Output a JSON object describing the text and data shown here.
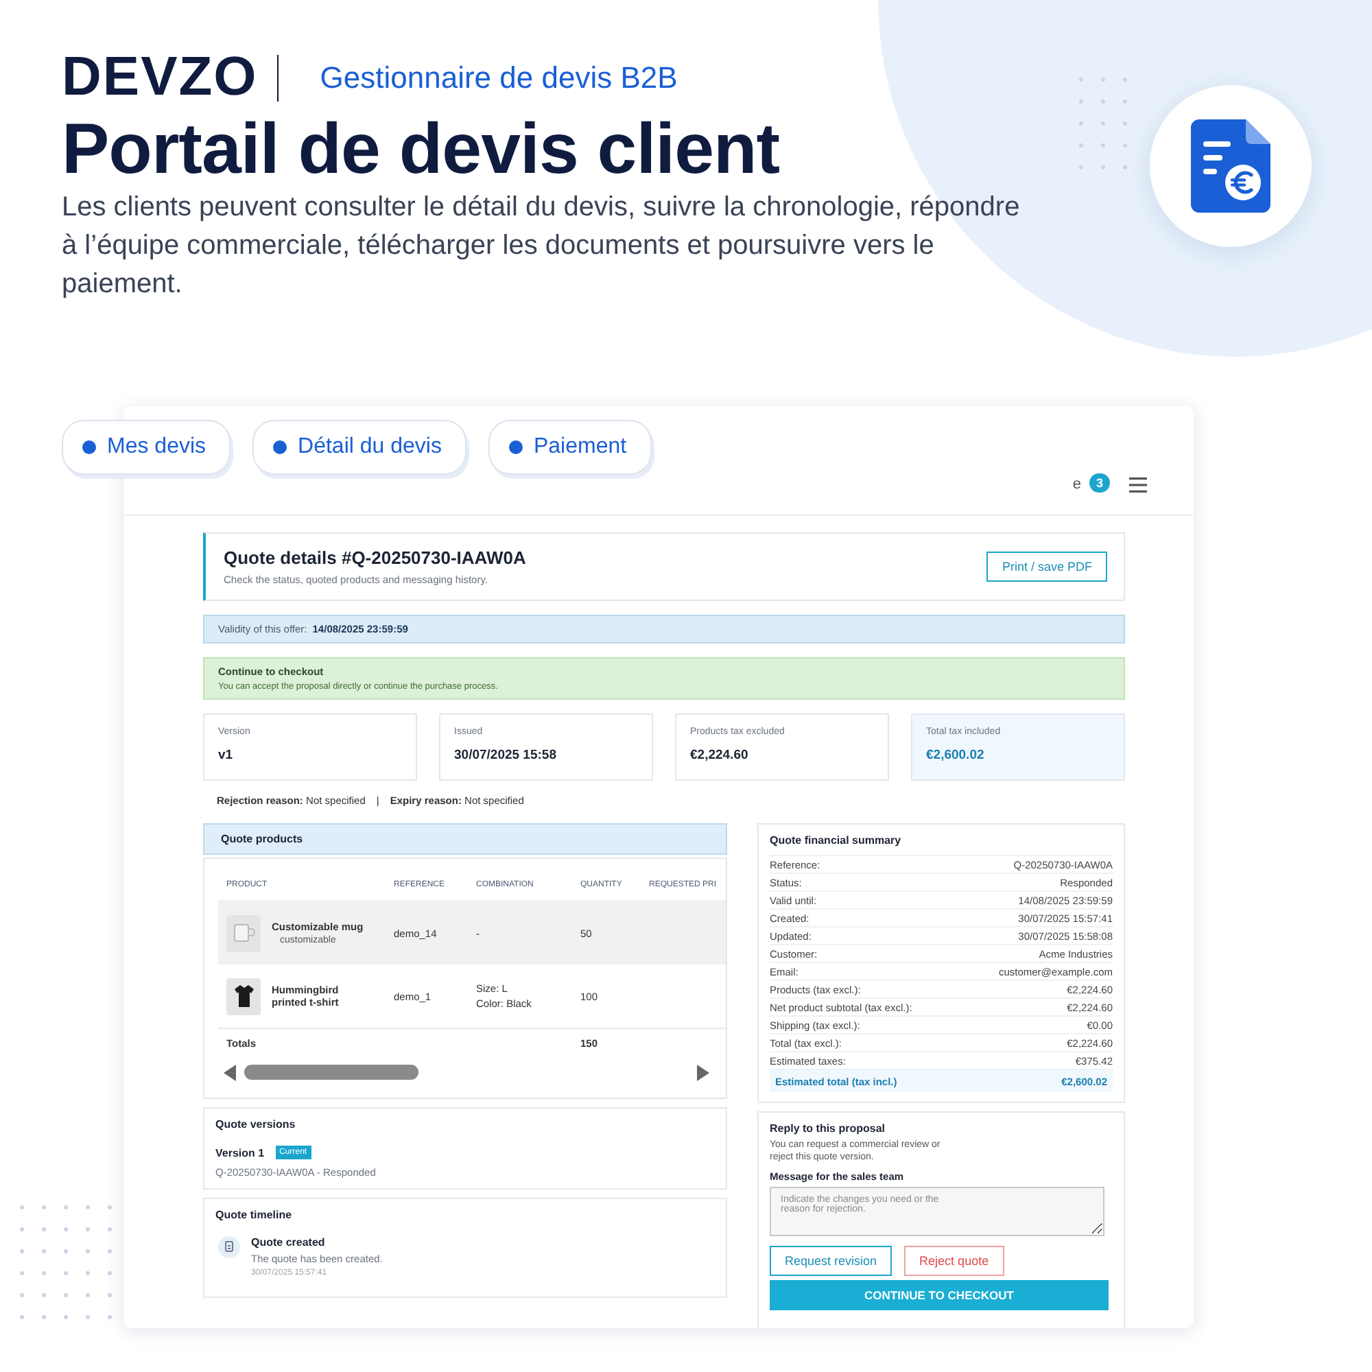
{
  "brand": {
    "logo": "DEVZO",
    "tagline": "Gestionnaire de devis B2B"
  },
  "headline": "Portail de devis client",
  "description": "Les clients peuvent consulter le détail du devis, suivre la chronologie, répondre à l’équipe commerciale, télécharger les documents et poursuivre vers le paiement.",
  "pills": [
    {
      "label": "Mes devis"
    },
    {
      "label": "Détail du devis"
    },
    {
      "label": "Paiement"
    }
  ],
  "topbar": {
    "cut_text": "e",
    "badge": "3"
  },
  "quote": {
    "title": "Quote details #Q-20250730-IAAW0A",
    "subtitle": "Check the status, quoted products and messaging history.",
    "print_button": "Print / save PDF"
  },
  "validity": {
    "label": "Validity of this offer:",
    "value": "14/08/2025 23:59:59"
  },
  "checkout_notice": {
    "title": "Continue to checkout",
    "text": "You can accept the proposal directly or continue the purchase process."
  },
  "stats": [
    {
      "label": "Version",
      "value": "v1",
      "highlight": false
    },
    {
      "label": "Issued",
      "value": "30/07/2025 15:58",
      "highlight": false
    },
    {
      "label": "Products tax excluded",
      "value": "€2,224.60",
      "highlight": false
    },
    {
      "label": "Total tax included",
      "value": "€2,600.02",
      "highlight": true
    }
  ],
  "reasons": [
    {
      "label": "Rejection reason:",
      "value": "Not specified"
    },
    {
      "label": "Expiry reason:",
      "value": "Not specified"
    }
  ],
  "reason_separator": "|",
  "products": {
    "title": "Quote products",
    "columns": [
      "PRODUCT",
      "REFERENCE",
      "COMBINATION",
      "QUANTITY",
      "REQUESTED PRI"
    ],
    "rows": [
      {
        "name": "Customizable mug",
        "note": "customizable",
        "reference": "demo_14",
        "combination": [
          "-"
        ],
        "quantity": "50",
        "kind": "mug",
        "shaded": true
      },
      {
        "name": "Hummingbird printed t-shirt",
        "reference": "demo_1",
        "combination": [
          "Size: L",
          "Color: Black"
        ],
        "quantity": "100",
        "kind": "shirt",
        "shaded": false
      }
    ],
    "totals": {
      "label": "Totals",
      "quantity": "150"
    }
  },
  "versions": {
    "title": "Quote versions",
    "items": [
      {
        "name": "Version 1",
        "badge": "Current",
        "detail": "Q-20250730-IAAW0A - Responded"
      }
    ]
  },
  "timeline": {
    "title": "Quote timeline",
    "events": [
      {
        "title": "Quote created",
        "text": "The quote has been created.",
        "time": "30/07/2025 15:57:41"
      }
    ]
  },
  "summary": {
    "title": "Quote financial summary",
    "rows": [
      {
        "label": "Reference:",
        "value": "Q-20250730-IAAW0A"
      },
      {
        "label": "Status:",
        "value": "Responded"
      },
      {
        "label": "Valid until:",
        "value": "14/08/2025 23:59:59"
      },
      {
        "label": "Created:",
        "value": "30/07/2025 15:57:41"
      },
      {
        "label": "Updated:",
        "value": "30/07/2025 15:58:08"
      },
      {
        "label": "Customer:",
        "value": "Acme Industries"
      },
      {
        "label": "Email:",
        "value": "customer@example.com"
      },
      {
        "label": "Products (tax excl.):",
        "value": "€2,224.60"
      },
      {
        "label": "Net product subtotal (tax excl.):",
        "value": "€2,224.60"
      },
      {
        "label": "Shipping (tax excl.):",
        "value": "€0.00"
      },
      {
        "label": "Total (tax excl.):",
        "value": "€2,224.60"
      },
      {
        "label": "Estimated taxes:",
        "value": "€375.42"
      }
    ],
    "total": {
      "label": "Estimated total (tax incl.)",
      "value": "€2,600.02"
    }
  },
  "reply": {
    "title": "Reply to this proposal",
    "text": "You can request a commercial review or reject this quote version.",
    "message_label": "Message for the sales team",
    "placeholder": "Indicate the changes you need or the reason for rejection.",
    "revision_button": "Request revision",
    "reject_button": "Reject quote",
    "checkout_button": "CONTINUE TO CHECKOUT"
  }
}
